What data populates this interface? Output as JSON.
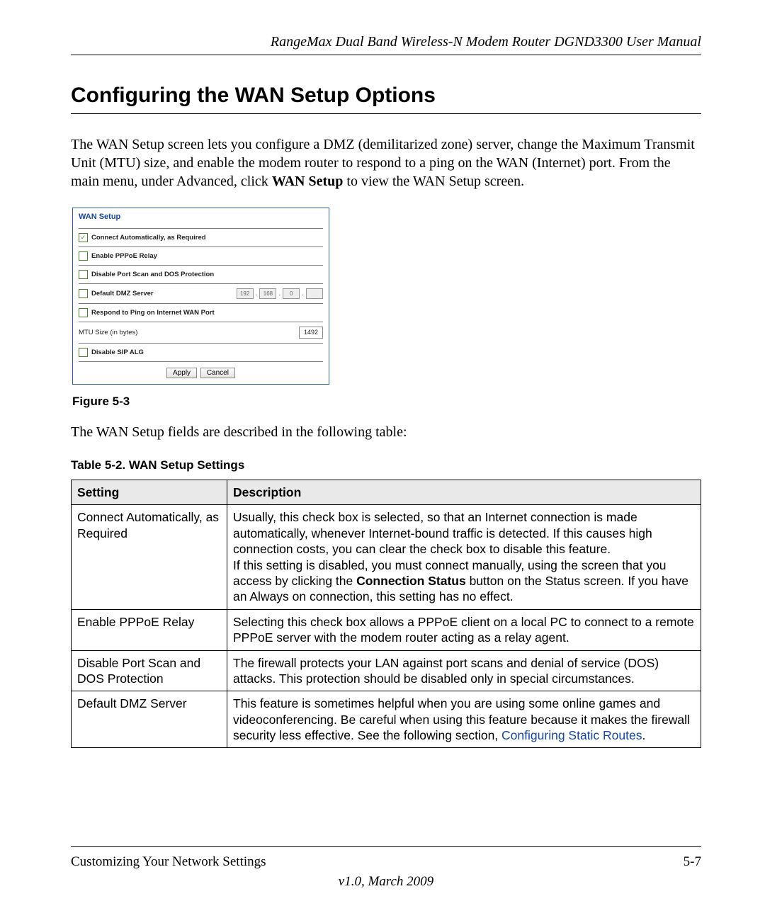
{
  "header": {
    "running_title": "RangeMax Dual Band Wireless-N Modem Router DGND3300 User Manual"
  },
  "section": {
    "title": "Configuring the WAN Setup Options",
    "intro_parts": {
      "p1": "The WAN Setup screen lets you configure a DMZ (demilitarized zone) server, change the Maximum Transmit Unit (MTU) size, and enable the modem router to respond to a ping on the WAN (Internet) port. From the main menu, under Advanced, click ",
      "bold": "WAN Setup",
      "p2": " to view the WAN Setup screen."
    },
    "after_figure": "The WAN Setup fields are described in the following table:"
  },
  "screenshot": {
    "title": "WAN Setup",
    "rows": {
      "connect_auto": {
        "checked": true,
        "label": "Connect Automatically, as Required"
      },
      "pppoe_relay": {
        "checked": false,
        "label": "Enable PPPoE Relay"
      },
      "disable_portscan": {
        "checked": false,
        "label": "Disable Port Scan and DOS Protection"
      },
      "dmz": {
        "checked": false,
        "label": "Default DMZ Server",
        "ip": [
          "192",
          "168",
          "0",
          ""
        ]
      },
      "respond_ping": {
        "checked": false,
        "label": "Respond to Ping on Internet WAN Port"
      },
      "mtu": {
        "label": "MTU Size (in bytes)",
        "value": "1492"
      },
      "sip_alg": {
        "checked": false,
        "label": "Disable SIP ALG"
      }
    },
    "buttons": {
      "apply": "Apply",
      "cancel": "Cancel"
    }
  },
  "figure_caption": "Figure 5-3",
  "table_caption": "Table 5-2.   WAN Setup Settings",
  "table": {
    "headers": {
      "c1": "Setting",
      "c2": "Description"
    },
    "rows": [
      {
        "setting": "Connect Automatically, as Required",
        "desc_parts": {
          "before": "Usually, this check box is selected, so that an Internet connection is made automatically, whenever Internet-bound traffic is detected. If this causes high connection costs, you can clear the check box to disable this feature.\nIf this setting is disabled, you must connect manually, using the screen that you access by clicking the ",
          "bold": "Connection Status",
          "after": " button on the Status screen. If you have an Always on connection, this setting has no effect."
        }
      },
      {
        "setting": "Enable PPPoE Relay",
        "desc": "Selecting this check box allows a PPPoE client on a local PC to connect to a remote PPPoE server with the modem router acting as a relay agent."
      },
      {
        "setting": "Disable Port Scan and DOS Protection",
        "desc": "The firewall protects your LAN against port scans and denial of service (DOS) attacks. This protection should be disabled only in special circumstances."
      },
      {
        "setting": "Default DMZ Server",
        "desc_parts": {
          "before": "This feature is sometimes helpful when you are using some online games and videoconferencing. Be careful when using this feature because it makes the firewall security less effective. See the following section, ",
          "link": "Configuring Static Routes",
          "after": "."
        }
      }
    ]
  },
  "footer": {
    "left": "Customizing Your Network Settings",
    "right": "5-7",
    "version": "v1.0, March 2009"
  }
}
